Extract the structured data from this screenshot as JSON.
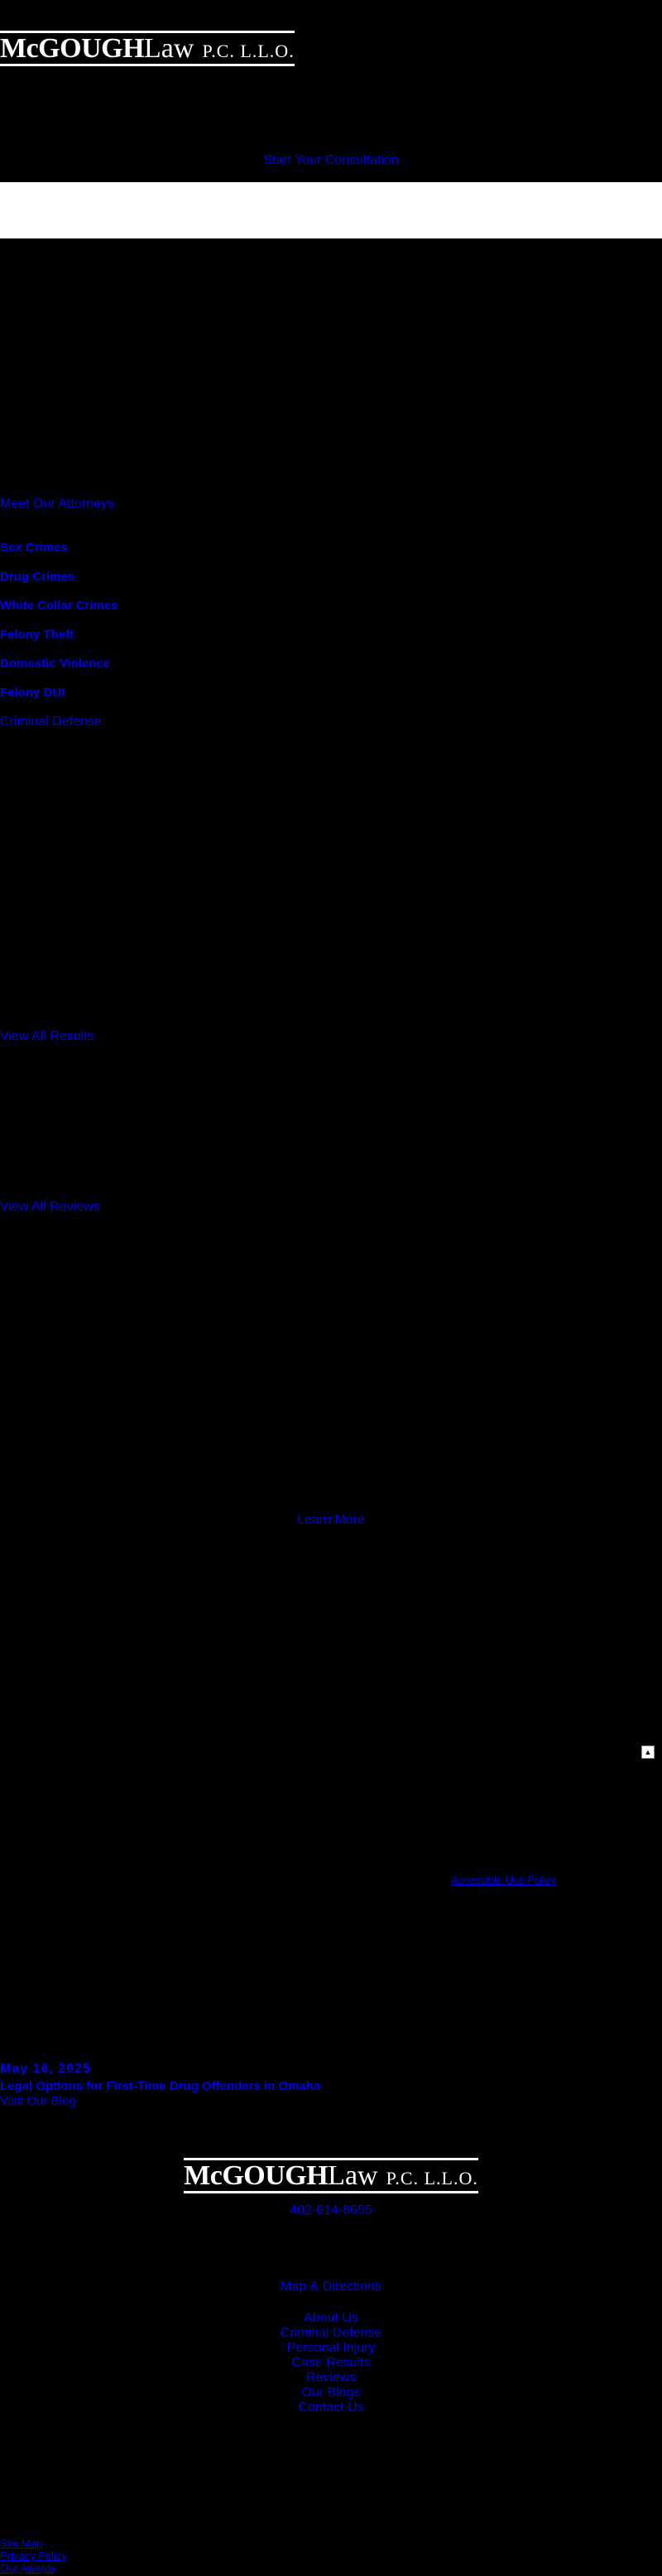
{
  "header": {
    "logo": {
      "main": "McGOUGH",
      "law": "Law",
      "suffix": "P.C. L.L.O."
    },
    "consultation_label": "Start Your Consultation"
  },
  "attorneys": {
    "link_label": "Meet Our Attorneys"
  },
  "practice_areas": {
    "items": [
      "Sex Crimes",
      "Drug Crimes",
      "White Collar Crimes",
      "Felony Theft",
      "Domestic Violence",
      "Felony DUI"
    ],
    "more_label": "Criminal Defense"
  },
  "results": {
    "link_label": "View All Results"
  },
  "reviews": {
    "link_label": "View All Reviews"
  },
  "about": {
    "learn_more_label": "Learn More"
  },
  "accessibility": {
    "link_label": "Accessible Use Policy",
    "scroll_icon": "chevron-up-icon"
  },
  "blog": {
    "date": "May 16, 2025",
    "post_title": "Legal Options for First-Time Drug Offenders in Omaha",
    "visit_label": "Visit Our Blog"
  },
  "footer": {
    "logo": {
      "main": "McGOUGH",
      "law": "Law",
      "suffix": "P.C. L.L.O."
    },
    "phone": "402-614-8655",
    "map_label": "Map & Directions",
    "nav": [
      "About Us",
      "Criminal Defense",
      "Personal Injury",
      "Case Results",
      "Reviews",
      "Our Blogs",
      "Contact Us"
    ],
    "legal": [
      "Site Map",
      "Privacy Policy",
      "Our Awards"
    ]
  },
  "colors": {
    "background": "#000000",
    "link": "#0000ee",
    "logo": "#ffffff",
    "band": "#ffffff"
  }
}
